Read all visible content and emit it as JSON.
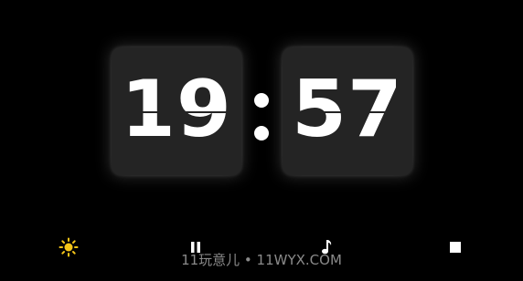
{
  "clock": {
    "hours": "19",
    "minutes": "57"
  },
  "toolbar": {
    "brightness_icon": "sun-icon",
    "pause_icon": "pause-icon",
    "music_icon": "music-note-icon",
    "stop_icon": "stop-icon",
    "accent_color": "#f5c518"
  },
  "watermark": {
    "text": "11玩意儿 • 11WYX.COM"
  }
}
